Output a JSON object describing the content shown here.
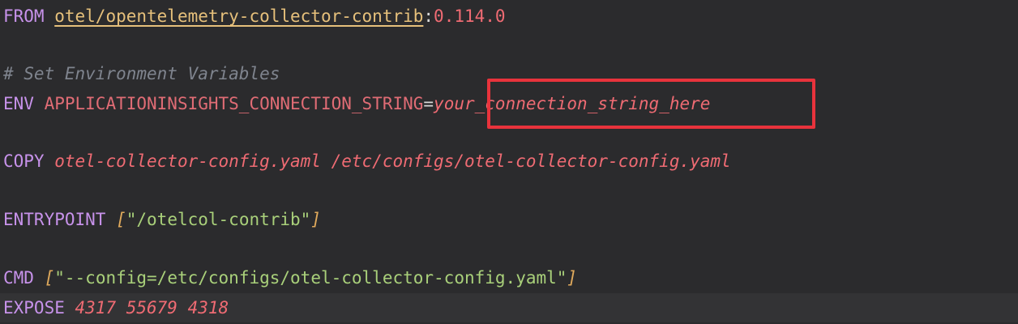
{
  "editor": {
    "line_from": {
      "keyword": "FROM",
      "image": "otel/opentelemetry-collector-contrib",
      "separator": ":",
      "tag": "0.114.0"
    },
    "line_comment": {
      "text": "# Set Environment Variables"
    },
    "line_env": {
      "keyword": "ENV",
      "name": "APPLICATIONINSIGHTS_CONNECTION_STRING",
      "equals": "=",
      "value": "your_connection_string_here"
    },
    "line_copy": {
      "keyword": "COPY",
      "args": "otel-collector-config.yaml /etc/configs/otel-collector-config.yaml"
    },
    "line_entrypoint": {
      "keyword": "ENTRYPOINT",
      "open_bracket": "[",
      "arg": "\"/otelcol-contrib\"",
      "close_bracket": "]"
    },
    "line_cmd": {
      "keyword": "CMD",
      "open_bracket": "[",
      "arg": "\"--config=/etc/configs/otel-collector-config.yaml\"",
      "close_bracket": "]"
    },
    "line_expose": {
      "keyword": "EXPOSE",
      "ports": "4317 55679 4318"
    }
  },
  "colors": {
    "background": "#2b2b2d",
    "keyword": "#c792ea",
    "env_name": "#e06c75",
    "string": "#a9d07a",
    "number": "#ef6b73",
    "comment": "#7f848e",
    "highlight_border": "#e8333c"
  }
}
